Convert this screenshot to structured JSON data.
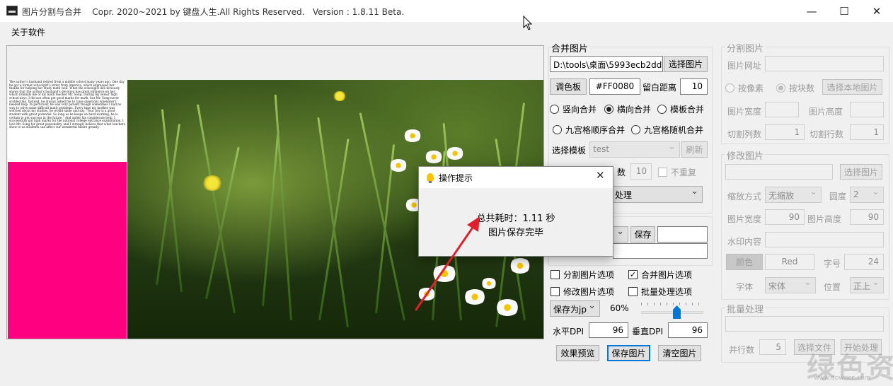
{
  "window": {
    "title": "图片分割与合并",
    "copyright": "Copr. 2020~2021 by 键盘人生.All Rights Reserved.",
    "version": "Version : 1.8.11 Beta.",
    "minimize": "—",
    "maximize": "☐",
    "close": "✕"
  },
  "menu": {
    "about": "关于软件"
  },
  "preview": {
    "doc_text": "The author's husband retired from a middle school many years ago. One day he got a former schoolgirl's letter from America, which expressed her thanks for helping her study math well. What the schoolgirl did obviously shows that the author's husband's devotion has great influence on her, which reminds me of my math teacher Mr. Song. During my senior high school days, I did not often get good marks for math, but Mr. Song never scolded me. Instead, he always asked me to raise questions whenever I needed help. In particular, he was very patient though sometimes I had no way to solve some difficult math problems. Every time my mother was worried about my studies, he would smile and say, \"Your boy is a good student with great potential. So long as he keeps on hard-working, he is certain to get success in the future.\" And under his considerate help, I successfully got high marks for the national college entrance examination. I love Mr. Song for great personality, and I strongly believe that what teachers show to us students can affect our wonderful future greatly."
  },
  "merge": {
    "title": "合并图片",
    "path": "D:\\tools\\桌面\\5993ecb2dd.",
    "select_btn": "选择图片",
    "palette_btn": "调色板",
    "color": "#FF0080",
    "margin_label": "留白距离",
    "margin": "10",
    "radio_vertical": "竖向合并",
    "radio_horizontal": "横向合并",
    "radio_template": "模板合并",
    "radio_grid_seq": "九宫格顺序合并",
    "radio_grid_rand": "九宫格随机合并",
    "template_label": "选择模板",
    "template_value": "test",
    "refresh_btn": "刷新",
    "count_label_partial": "数",
    "count_value": "10",
    "no_repeat": "不重复",
    "process_partial": "处理",
    "save_btn": "保存"
  },
  "options": {
    "split_opt": "分割图片选项",
    "merge_opt": "合并图片选项",
    "modify_opt": "修改图片选项",
    "batch_opt": "批量处理选项",
    "format": "保存为jp",
    "quality": "60%",
    "quality_fraction": 0.6,
    "hdpi_label": "水平DPI",
    "hdpi": "96",
    "vdpi_label": "垂直DPI",
    "vdpi": "96",
    "preview_btn": "效果预览",
    "save_img_btn": "保存图片",
    "clear_btn": "清空图片"
  },
  "split": {
    "title": "分割图片",
    "url_label": "图片网址",
    "by_pixel": "按像素",
    "by_block": "按块数",
    "select_local": "选择本地图片",
    "width_label": "图片宽度",
    "height_label": "图片高度",
    "cols_label": "切割列数",
    "cols": "1",
    "rows_label": "切割行数",
    "rows": "1"
  },
  "modify": {
    "title": "修改图片",
    "select_btn": "选择图片",
    "scale_label": "缩放方式",
    "scale_value": "无缩放",
    "angle_label": "圆度",
    "angle_value": "2",
    "width_label": "图片宽度",
    "width": "90",
    "height_label": "图片高度",
    "height": "90",
    "watermark_label": "水印内容",
    "color_btn": "颜色",
    "color_value": "Red",
    "size_label": "字号",
    "size_value": "24",
    "font_label": "字体",
    "font_value": "宋体",
    "pos_label": "位置",
    "pos_value": "正上"
  },
  "batch": {
    "title": "批量处理",
    "threads_label": "并行数",
    "threads": "5",
    "btn1": "选择文件",
    "btn2": "开始处理"
  },
  "dialog": {
    "title": "操作提示",
    "close": "✕",
    "line1": "总共耗时：1.11 秒",
    "line2": "图片保存完毕"
  },
  "watermark": {
    "text": "绿色资源网",
    "sub": "www.downcc.com"
  },
  "colors": {
    "accent": "#0078d7",
    "magenta": "#ff0080",
    "arrow": "#e0202a"
  }
}
